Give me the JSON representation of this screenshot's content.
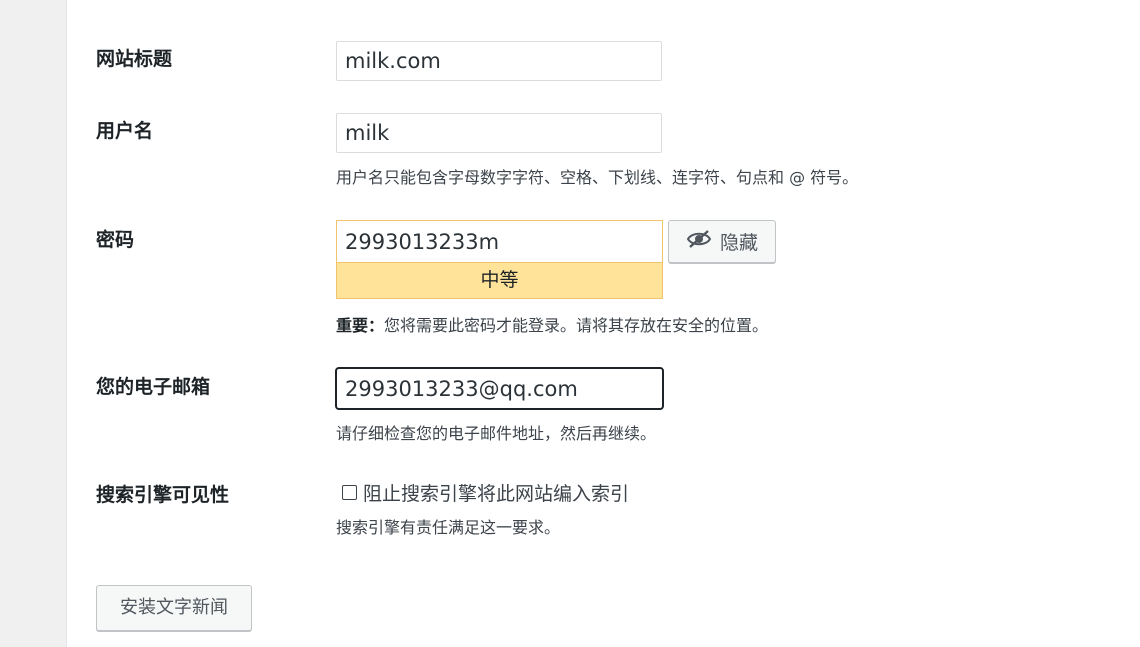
{
  "form": {
    "site_title": {
      "label": "网站标题",
      "value": "milk.com"
    },
    "username": {
      "label": "用户名",
      "value": "milk",
      "description": "用户名只能包含字母数字字符、空格、下划线、连字符、句点和 @ 符号。"
    },
    "password": {
      "label": "密码",
      "value": "2993013233m",
      "strength": "中等",
      "hide_button_label": "隐藏",
      "hide_icon": "eye-slash-icon",
      "note_strong": "重要：",
      "note": "您将需要此密码才能登录。请将其存放在安全的位置。"
    },
    "email": {
      "label": "您的电子邮箱",
      "value": "2993013233@qq.com",
      "description": "请仔细检查您的电子邮件地址，然后再继续。"
    },
    "search_visibility": {
      "label": "搜索引擎可见性",
      "checkbox_label": "阻止搜索引擎将此网站编入索引",
      "checked": false,
      "description": "搜索引擎有责任满足这一要求。"
    },
    "submit_label": "安装文字新闻"
  },
  "colors": {
    "strength_medium_bg": "#ffe399",
    "strength_medium_border": "#f0c36d"
  }
}
